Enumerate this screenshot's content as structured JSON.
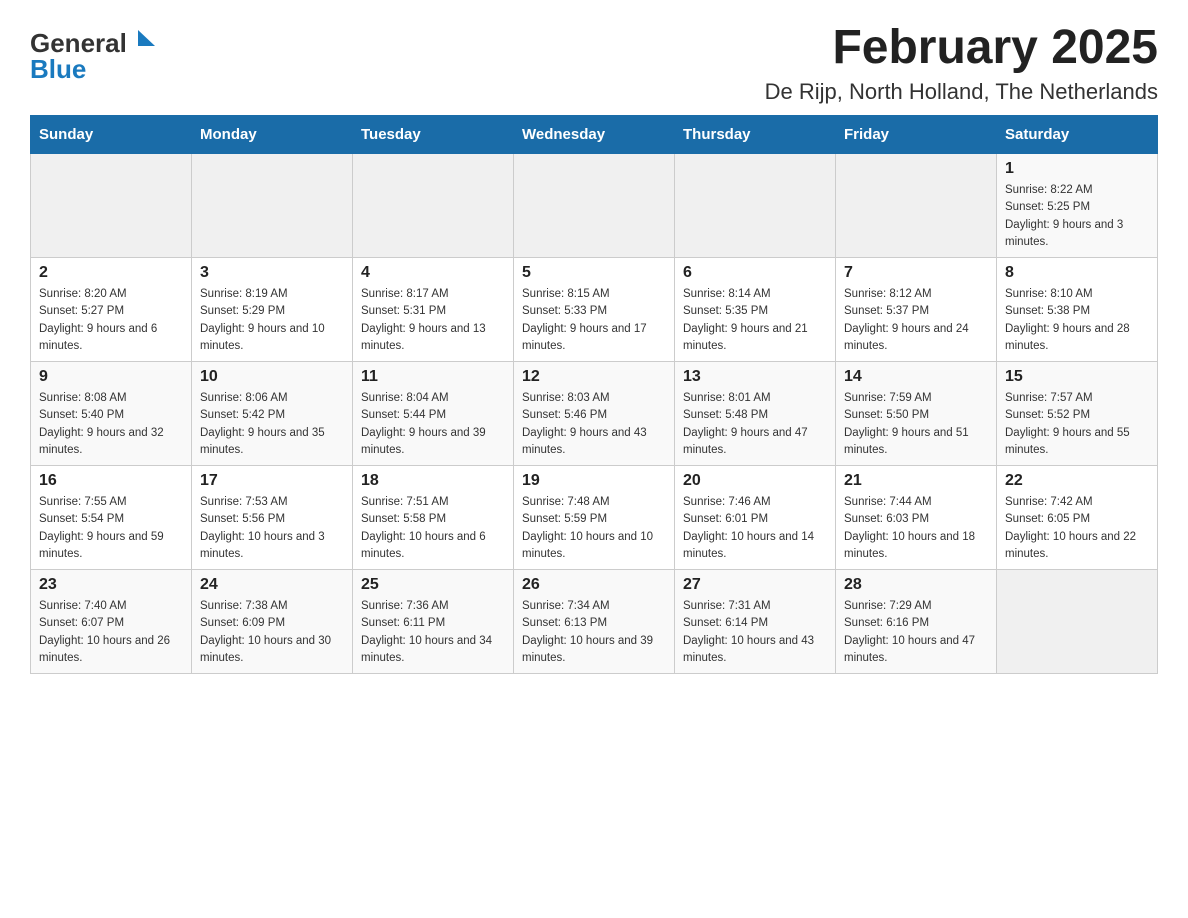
{
  "header": {
    "logo_general": "General",
    "logo_blue": "Blue",
    "title": "February 2025",
    "subtitle": "De Rijp, North Holland, The Netherlands"
  },
  "days_of_week": [
    "Sunday",
    "Monday",
    "Tuesday",
    "Wednesday",
    "Thursday",
    "Friday",
    "Saturday"
  ],
  "weeks": [
    [
      {
        "day": "",
        "info": ""
      },
      {
        "day": "",
        "info": ""
      },
      {
        "day": "",
        "info": ""
      },
      {
        "day": "",
        "info": ""
      },
      {
        "day": "",
        "info": ""
      },
      {
        "day": "",
        "info": ""
      },
      {
        "day": "1",
        "info": "Sunrise: 8:22 AM\nSunset: 5:25 PM\nDaylight: 9 hours and 3 minutes."
      }
    ],
    [
      {
        "day": "2",
        "info": "Sunrise: 8:20 AM\nSunset: 5:27 PM\nDaylight: 9 hours and 6 minutes."
      },
      {
        "day": "3",
        "info": "Sunrise: 8:19 AM\nSunset: 5:29 PM\nDaylight: 9 hours and 10 minutes."
      },
      {
        "day": "4",
        "info": "Sunrise: 8:17 AM\nSunset: 5:31 PM\nDaylight: 9 hours and 13 minutes."
      },
      {
        "day": "5",
        "info": "Sunrise: 8:15 AM\nSunset: 5:33 PM\nDaylight: 9 hours and 17 minutes."
      },
      {
        "day": "6",
        "info": "Sunrise: 8:14 AM\nSunset: 5:35 PM\nDaylight: 9 hours and 21 minutes."
      },
      {
        "day": "7",
        "info": "Sunrise: 8:12 AM\nSunset: 5:37 PM\nDaylight: 9 hours and 24 minutes."
      },
      {
        "day": "8",
        "info": "Sunrise: 8:10 AM\nSunset: 5:38 PM\nDaylight: 9 hours and 28 minutes."
      }
    ],
    [
      {
        "day": "9",
        "info": "Sunrise: 8:08 AM\nSunset: 5:40 PM\nDaylight: 9 hours and 32 minutes."
      },
      {
        "day": "10",
        "info": "Sunrise: 8:06 AM\nSunset: 5:42 PM\nDaylight: 9 hours and 35 minutes."
      },
      {
        "day": "11",
        "info": "Sunrise: 8:04 AM\nSunset: 5:44 PM\nDaylight: 9 hours and 39 minutes."
      },
      {
        "day": "12",
        "info": "Sunrise: 8:03 AM\nSunset: 5:46 PM\nDaylight: 9 hours and 43 minutes."
      },
      {
        "day": "13",
        "info": "Sunrise: 8:01 AM\nSunset: 5:48 PM\nDaylight: 9 hours and 47 minutes."
      },
      {
        "day": "14",
        "info": "Sunrise: 7:59 AM\nSunset: 5:50 PM\nDaylight: 9 hours and 51 minutes."
      },
      {
        "day": "15",
        "info": "Sunrise: 7:57 AM\nSunset: 5:52 PM\nDaylight: 9 hours and 55 minutes."
      }
    ],
    [
      {
        "day": "16",
        "info": "Sunrise: 7:55 AM\nSunset: 5:54 PM\nDaylight: 9 hours and 59 minutes."
      },
      {
        "day": "17",
        "info": "Sunrise: 7:53 AM\nSunset: 5:56 PM\nDaylight: 10 hours and 3 minutes."
      },
      {
        "day": "18",
        "info": "Sunrise: 7:51 AM\nSunset: 5:58 PM\nDaylight: 10 hours and 6 minutes."
      },
      {
        "day": "19",
        "info": "Sunrise: 7:48 AM\nSunset: 5:59 PM\nDaylight: 10 hours and 10 minutes."
      },
      {
        "day": "20",
        "info": "Sunrise: 7:46 AM\nSunset: 6:01 PM\nDaylight: 10 hours and 14 minutes."
      },
      {
        "day": "21",
        "info": "Sunrise: 7:44 AM\nSunset: 6:03 PM\nDaylight: 10 hours and 18 minutes."
      },
      {
        "day": "22",
        "info": "Sunrise: 7:42 AM\nSunset: 6:05 PM\nDaylight: 10 hours and 22 minutes."
      }
    ],
    [
      {
        "day": "23",
        "info": "Sunrise: 7:40 AM\nSunset: 6:07 PM\nDaylight: 10 hours and 26 minutes."
      },
      {
        "day": "24",
        "info": "Sunrise: 7:38 AM\nSunset: 6:09 PM\nDaylight: 10 hours and 30 minutes."
      },
      {
        "day": "25",
        "info": "Sunrise: 7:36 AM\nSunset: 6:11 PM\nDaylight: 10 hours and 34 minutes."
      },
      {
        "day": "26",
        "info": "Sunrise: 7:34 AM\nSunset: 6:13 PM\nDaylight: 10 hours and 39 minutes."
      },
      {
        "day": "27",
        "info": "Sunrise: 7:31 AM\nSunset: 6:14 PM\nDaylight: 10 hours and 43 minutes."
      },
      {
        "day": "28",
        "info": "Sunrise: 7:29 AM\nSunset: 6:16 PM\nDaylight: 10 hours and 47 minutes."
      },
      {
        "day": "",
        "info": ""
      }
    ]
  ]
}
